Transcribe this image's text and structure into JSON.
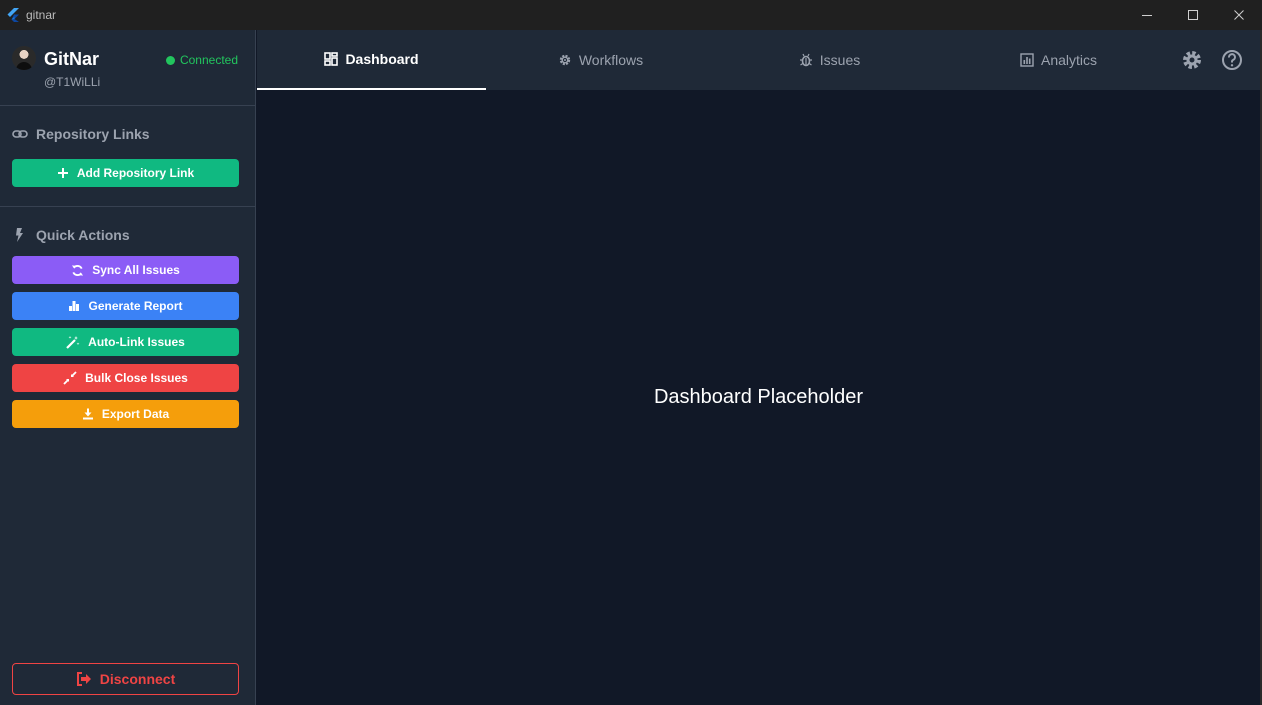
{
  "window": {
    "title": "gitnar",
    "minimize_glyph": "—",
    "maximize_glyph": "☐",
    "close_glyph": "✕"
  },
  "profile": {
    "app_name": "GitNar",
    "username": "@T1WiLLi",
    "status": "Connected"
  },
  "sections": {
    "repository_links": {
      "title": "Repository Links",
      "add_button": "Add Repository Link"
    },
    "quick_actions": {
      "title": "Quick Actions",
      "buttons": [
        {
          "label": "Sync All Issues",
          "icon": "sync-icon",
          "color": "#8b5cf6"
        },
        {
          "label": "Generate Report",
          "icon": "bar-chart-icon",
          "color": "#3b82f6"
        },
        {
          "label": "Auto-Link Issues",
          "icon": "magic-wand-icon",
          "color": "#10b981"
        },
        {
          "label": "Bulk Close Issues",
          "icon": "compress-icon",
          "color": "#ef4444"
        },
        {
          "label": "Export Data",
          "icon": "download-icon",
          "color": "#f59e0b"
        }
      ]
    }
  },
  "disconnect_label": "Disconnect",
  "tabs": [
    {
      "label": "Dashboard",
      "icon": "dashboard-icon",
      "active": true
    },
    {
      "label": "Workflows",
      "icon": "gear-cog-icon",
      "active": false
    },
    {
      "label": "Issues",
      "icon": "bug-icon",
      "active": false
    },
    {
      "label": "Analytics",
      "icon": "analytics-icon",
      "active": false
    }
  ],
  "toolbar": {
    "settings_icon": "settings-icon",
    "help_icon": "help-icon"
  },
  "main": {
    "placeholder": "Dashboard Placeholder"
  },
  "colors": {
    "accent_green": "#10b981",
    "connected_green": "#22c55e",
    "danger_red": "#ef4444",
    "sidebar_bg": "#1f2937",
    "content_bg": "#111827"
  }
}
